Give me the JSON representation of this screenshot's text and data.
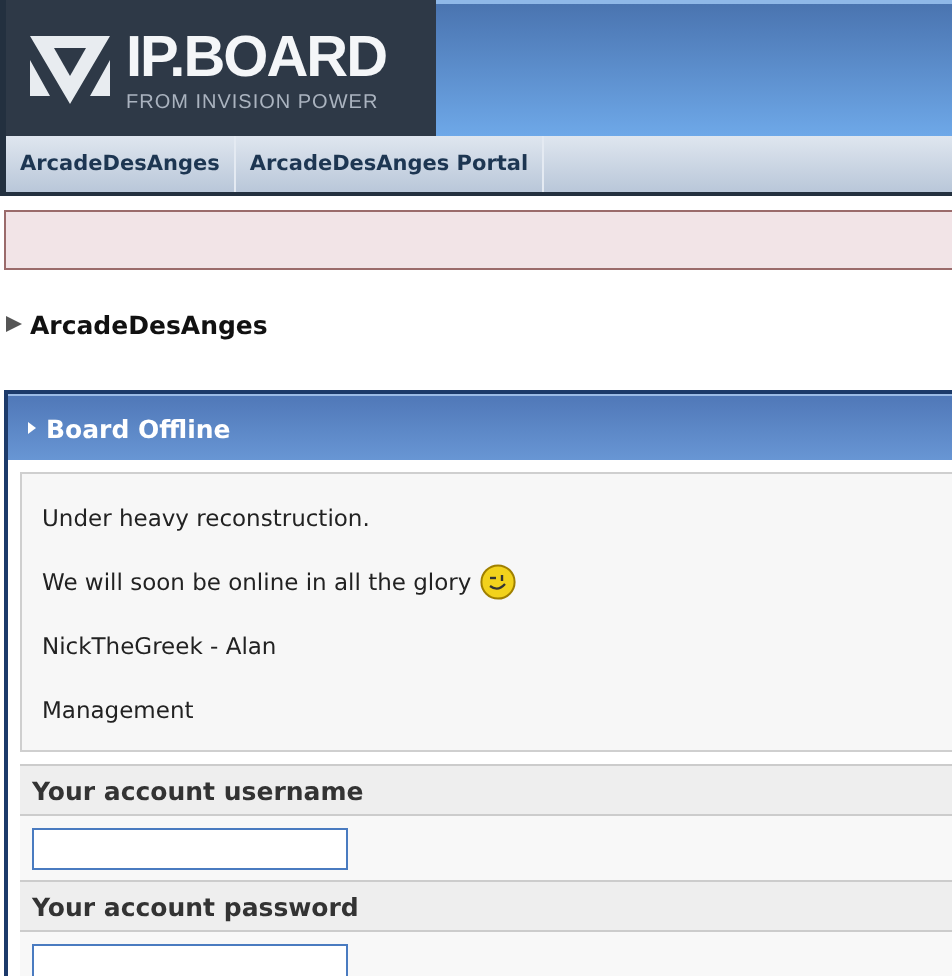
{
  "logo": {
    "title": "IP.BOARD",
    "subtitle": "FROM INVISION POWER"
  },
  "nav": [
    {
      "label": "ArcadeDesAnges"
    },
    {
      "label": "ArcadeDesAnges Portal"
    }
  ],
  "breadcrumb": "ArcadeDesAnges",
  "box": {
    "title": "Board Offline",
    "lines": [
      {
        "text": "Under heavy reconstruction.",
        "emoticon": false
      },
      {
        "text": "We will soon be online in all the glory",
        "emoticon": true
      },
      {
        "text": "NickTheGreek - Alan",
        "emoticon": false
      },
      {
        "text": "Management",
        "emoticon": false
      }
    ]
  },
  "fields": [
    {
      "label": "Your account username"
    },
    {
      "label": "Your account password"
    }
  ]
}
